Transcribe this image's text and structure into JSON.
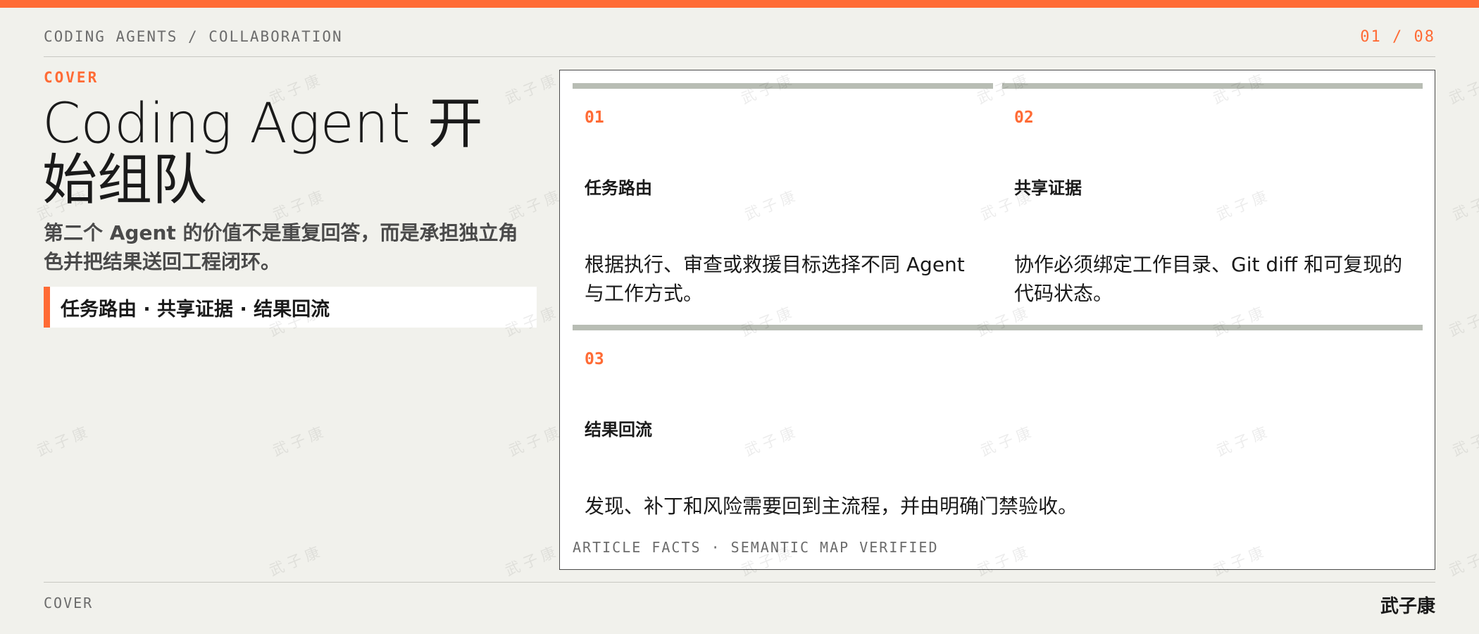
{
  "header": {
    "breadcrumb": "CODING AGENTS / COLLABORATION",
    "page_counter": "01 / 08"
  },
  "slide": {
    "kicker": "COVER",
    "title": "Coding Agent 开始组队",
    "subtitle": "第二个 Agent 的价值不是重复回答，而是承担独立角色并把结果送回工程闭环。",
    "tagline": "任务路由 · 共享证据 · 结果回流"
  },
  "cards": [
    {
      "num": "01",
      "title": "任务路由",
      "desc": "根据执行、审查或救援目标选择不同 Agent 与工作方式。"
    },
    {
      "num": "02",
      "title": "共享证据",
      "desc": "协作必须绑定工作目录、Git diff 和可复现的代码状态。"
    },
    {
      "num": "03",
      "title": "结果回流",
      "desc": "发现、补丁和风险需要回到主流程，并由明确门禁验收。"
    }
  ],
  "panel_footer": "ARTICLE FACTS · SEMANTIC MAP VERIFIED",
  "footer": {
    "section": "COVER",
    "author": "武子康"
  },
  "watermark": "武子康",
  "colors": {
    "accent": "#ff6b35",
    "background": "#f1f1ec",
    "card_bar": "#b8bdb4"
  }
}
